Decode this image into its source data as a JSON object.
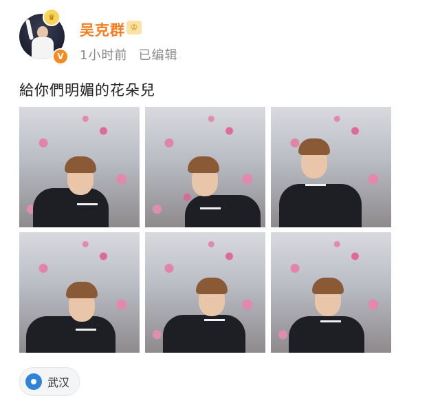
{
  "post": {
    "author": "吴克群",
    "time": "1小时前",
    "edited": "已编辑",
    "text": "給你們明媚的花朵兒",
    "location": "武汉",
    "verified_mark": "V"
  },
  "photos": [
    {
      "name": "photo-1"
    },
    {
      "name": "photo-2"
    },
    {
      "name": "photo-3"
    },
    {
      "name": "photo-4"
    },
    {
      "name": "photo-5"
    },
    {
      "name": "photo-6"
    }
  ],
  "icons": {
    "avatar_badge": "crown-icon",
    "vip_badge": "vip-icon",
    "location": "location-pin-icon"
  },
  "colors": {
    "username": "#f27e1f",
    "meta": "#8a8a8a",
    "verified": "#f58a1f",
    "pin": "#2f83d9"
  }
}
